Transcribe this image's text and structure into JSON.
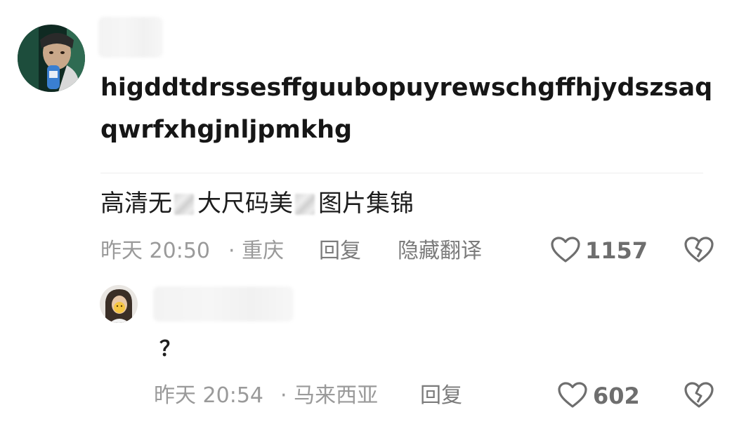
{
  "comment": {
    "text": "higddtdrssesffguubopuyrewschgffhjydszsaqqwrfxhgjnljpmkhg",
    "title_part1": "高清无",
    "title_part2": "大尺码美",
    "title_part3": "图片集锦",
    "timestamp": "昨天 20:50",
    "location": "· 重庆",
    "reply_label": "回复",
    "hide_translation_label": "隐藏翻译",
    "like_count": "1157"
  },
  "reply": {
    "text": "？",
    "timestamp": "昨天 20:54",
    "location": "· 马来西亚",
    "reply_label": "回复",
    "like_count": "602"
  },
  "icons": {
    "like": "heart-outline-icon",
    "dislike": "broken-heart-icon"
  },
  "colors": {
    "text_primary": "#161616",
    "text_meta": "#9a9a9a",
    "icon": "#6e6e6e"
  }
}
